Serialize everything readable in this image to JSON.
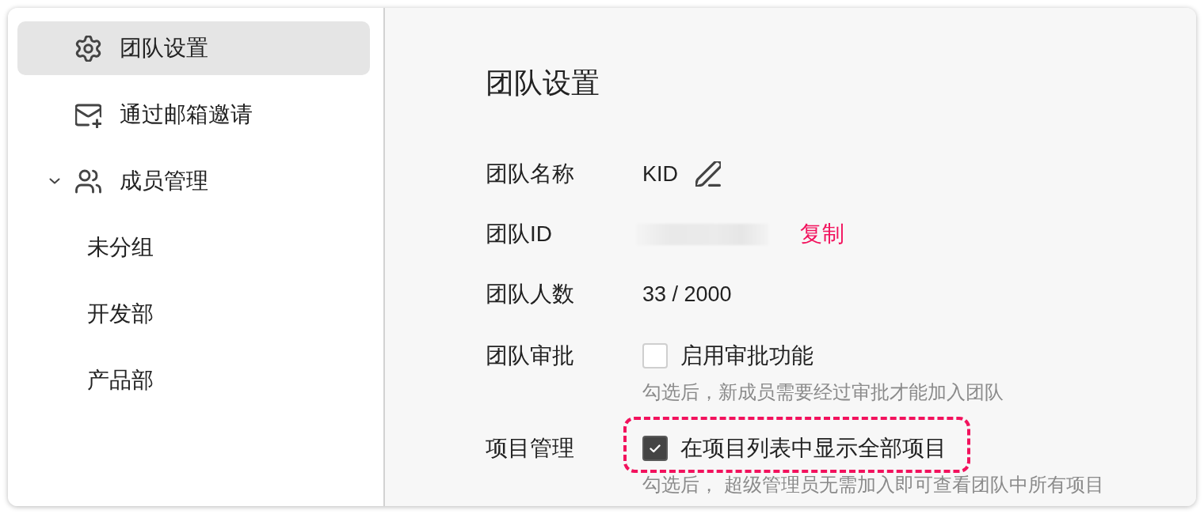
{
  "sidebar": {
    "items": [
      {
        "label": "团队设置",
        "selected": true
      },
      {
        "label": "通过邮箱邀请",
        "selected": false
      },
      {
        "label": "成员管理",
        "selected": false,
        "expanded": true,
        "children": [
          {
            "label": "未分组",
            "selected": false
          },
          {
            "label": "开发部",
            "selected": false
          },
          {
            "label": "产品部",
            "selected": false
          }
        ]
      }
    ]
  },
  "settings": {
    "title": "团队设置",
    "rows": [
      {
        "label": "团队名称",
        "kind": "editable",
        "value": "KID"
      },
      {
        "label": "团队ID",
        "kind": "redacted",
        "action": "复制"
      },
      {
        "label": "团队人数",
        "kind": "text",
        "value": "33 / 2000"
      },
      {
        "label": "团队审批",
        "kind": "checkbox",
        "option": "启用审批功能",
        "checked": false,
        "highlighted": false,
        "hint": "勾选后，新成员需要经过审批才能加入团队"
      },
      {
        "label": "项目管理",
        "kind": "checkbox",
        "option": "在项目列表中显示全部项目",
        "checked": true,
        "highlighted": true,
        "hint": "勾选后， 超级管理员无需加入即可查看团队中所有项目"
      }
    ]
  }
}
